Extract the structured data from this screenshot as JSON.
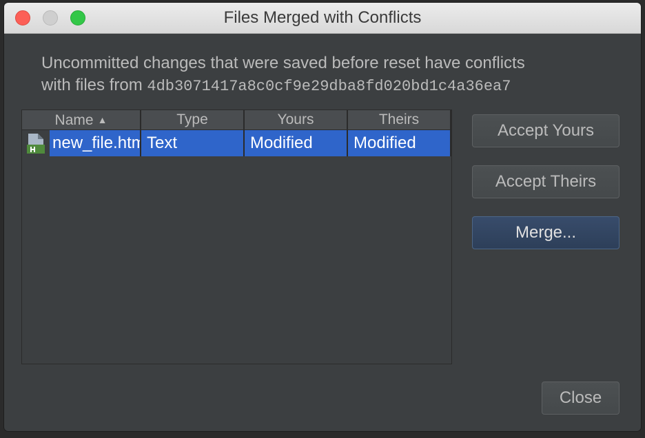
{
  "window": {
    "title": "Files Merged with Conflicts"
  },
  "message": {
    "line1": "Uncommitted changes that were saved before reset have conflicts",
    "line2_prefix": "with files from ",
    "commit_hash": "4db3071417a8c0cf9e29dba8fd020bd1c4a36ea7"
  },
  "table": {
    "columns": {
      "name": "Name",
      "type": "Type",
      "yours": "Yours",
      "theirs": "Theirs"
    },
    "sort_indicator": "▲",
    "rows": [
      {
        "icon": "html-file-icon",
        "name": "new_file.html",
        "type": "Text",
        "yours": "Modified",
        "theirs": "Modified"
      }
    ]
  },
  "buttons": {
    "accept_yours": "Accept Yours",
    "accept_theirs": "Accept Theirs",
    "merge": "Merge...",
    "close": "Close"
  },
  "colors": {
    "background": "#3c3f41",
    "selection": "#2f65ca",
    "default_button": "#2d3f59"
  }
}
